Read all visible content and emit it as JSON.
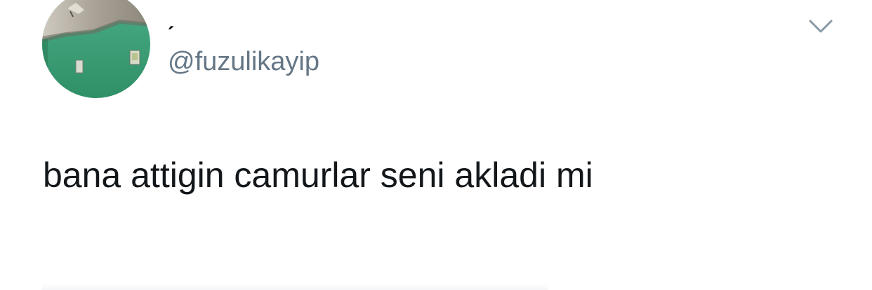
{
  "tweet": {
    "display_name": "ˏ",
    "handle": "@fuzulikayip",
    "text": "bana attigin camurlar seni akladi mi"
  },
  "icons": {
    "caret": "chevron-down-icon",
    "avatar": "profile-photo"
  },
  "colors": {
    "text_primary": "#14171a",
    "text_secondary": "#657786",
    "caret": "#8899a6",
    "avatar_wall": "#3aa57e"
  }
}
